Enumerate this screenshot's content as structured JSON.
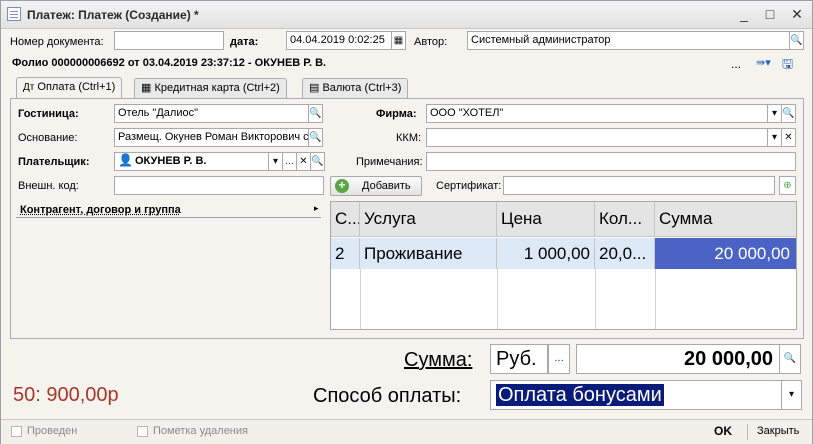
{
  "window": {
    "title": "Платеж: Платеж (Создание) *",
    "controls": [
      "_",
      "□",
      "✕"
    ]
  },
  "header": {
    "doc_number_label": "Номер документа:",
    "doc_number_value": "",
    "date_label": "дата:",
    "date_value": "04.04.2019  0:02:25",
    "author_label": "Автор:",
    "author_value": "Системный администратор",
    "folio_text": "Фолио 000000006692 от 03.04.2019 23:37:12 - ОКУНЕВ Р. В.",
    "ellipsis": "..."
  },
  "tabs": [
    {
      "label": "Оплата (Ctrl+1)",
      "icon": "Дт"
    },
    {
      "label": "Кредитная карта (Ctrl+2)"
    },
    {
      "label": "Валюта (Ctrl+3)"
    }
  ],
  "form": {
    "hotel_label": "Гостиница:",
    "hotel_value": "Отель \"Далиос\"",
    "basis_label": "Основание:",
    "basis_value": "Размещ. Окунев Роман Викторович с",
    "payer_label": "Плательщик:",
    "payer_value": "ОКУНЕВ Р. В.",
    "ext_code_label": "Внешн. код:",
    "ext_code_value": "",
    "firm_label": "Фирма:",
    "firm_value": "ООО \"ХОТЕЛ\"",
    "kkm_label": "ККМ:",
    "kkm_value": "",
    "note_label": "Примечания:",
    "note_value": "",
    "add_button": "Добавить",
    "cert_label": "Сертификат:",
    "cert_value": "",
    "contractor_group": "Контрагент, договор и группа"
  },
  "table": {
    "columns": [
      "С...",
      "Услуга",
      "Цена",
      "Кол...",
      "Сумма"
    ],
    "rows": [
      [
        "2",
        "Проживание",
        "1 000,00",
        "20,0...",
        "20 000,00"
      ]
    ]
  },
  "totals": {
    "sum_label": "Сумма:",
    "currency": "Руб.",
    "sum_value": "20 000,00",
    "payment_label": "Способ оплаты:",
    "payment_value": "Оплата бонусами",
    "bonus_text": "50: 900,00р"
  },
  "footer": {
    "posted": "Проведен",
    "deletion_mark": "Пометка удаления",
    "ok": "OK",
    "close": "Закрыть"
  },
  "colors": {
    "selected_sum_cell": "#4a63c4",
    "payment_highlight": "#0a1c7a",
    "bonus_text": "#a8362a"
  }
}
